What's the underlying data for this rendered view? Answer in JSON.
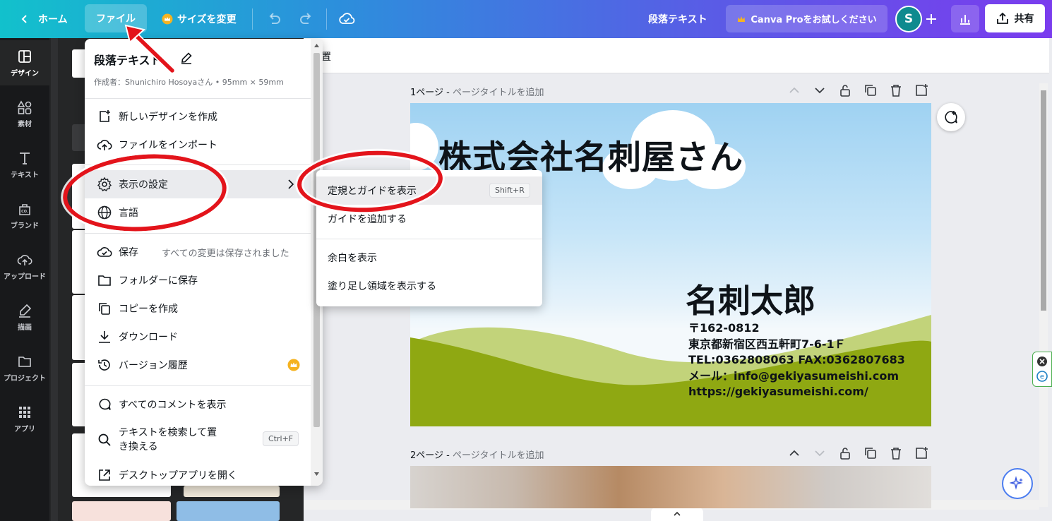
{
  "topbar": {
    "home_label": "ホーム",
    "file_label": "ファイル",
    "resize_label": "サイズを変更",
    "doc_title": "段落テキスト",
    "pro_label": "Canva Proをお試しください",
    "avatar_initial": "S",
    "share_label": "共有",
    "crown_color": "#f5b321"
  },
  "rail": {
    "items": [
      {
        "label": "デザイン",
        "icon": "layout-icon"
      },
      {
        "label": "素材",
        "icon": "shapes-icon"
      },
      {
        "label": "テキスト",
        "icon": "text-icon"
      },
      {
        "label": "ブランド",
        "icon": "brand-icon"
      },
      {
        "label": "アップロード",
        "icon": "upload-cloud-icon"
      },
      {
        "label": "描画",
        "icon": "draw-icon"
      },
      {
        "label": "プロジェクト",
        "icon": "folder-icon"
      },
      {
        "label": "アプリ",
        "icon": "apps-grid-icon"
      }
    ]
  },
  "context_bar": {
    "partial_text": "置"
  },
  "file_menu": {
    "title": "段落テキスト",
    "meta": "作成者：Shunichiro Hosoyaさん • 95mm × 59mm",
    "items": [
      {
        "label": "新しいデザインを作成"
      },
      {
        "label": "ファイルをインポート"
      },
      {
        "label": "表示の設定"
      },
      {
        "label": "言語"
      },
      {
        "label": "保存",
        "status": "すべての変更は保存されました"
      },
      {
        "label": "フォルダーに保存"
      },
      {
        "label": "コピーを作成"
      },
      {
        "label": "ダウンロード"
      },
      {
        "label": "バージョン履歴"
      },
      {
        "label": "すべてのコメントを表示"
      },
      {
        "label_line1": "テキストを検索して置",
        "label_line2": "き換える",
        "shortcut": "Ctrl+F"
      },
      {
        "label": "デスクトップアプリを開く"
      }
    ]
  },
  "submenu": {
    "items": [
      {
        "label": "定規とガイドを表示",
        "shortcut": "Shift+R"
      },
      {
        "label": "ガイドを追加する"
      },
      {
        "label": "余白を表示"
      },
      {
        "label": "塗り足し領域を表示する"
      }
    ]
  },
  "pages": [
    {
      "number": "1ページ - ",
      "title_placeholder": "ページタイトルを追加"
    },
    {
      "number": "2ページ - ",
      "title_placeholder": "ページタイトルを追加"
    }
  ],
  "card": {
    "company": "株式会社名刺屋さん",
    "name": "名刺太郎",
    "lines": [
      "〒162-0812",
      "東京都新宿区西五軒町7-6-1Ｆ",
      "TEL:0362808063 FAX:0362807683",
      "メール：info@gekiyasumeishi.com",
      "https://gekiyasumeishi.com/"
    ]
  },
  "colors": {
    "annotation": "#e3141b",
    "hill_dark": "#8fa812",
    "hill_light": "#c2d37a"
  }
}
